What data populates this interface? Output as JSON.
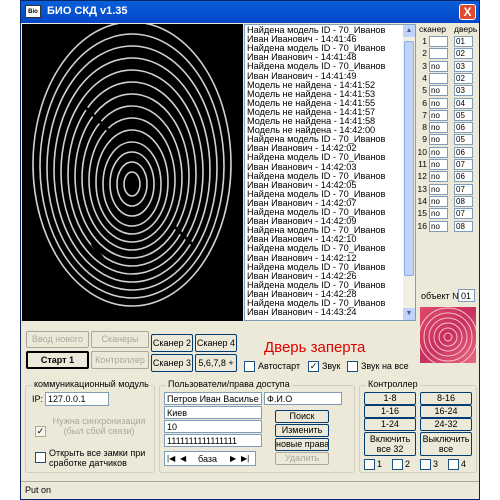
{
  "window": {
    "title": "БИО СКД  v1.35",
    "app_icon": "Bio",
    "close": "X"
  },
  "log": {
    "lines": [
      "Найдена модель ID - 70_Иванов",
      "Иван Иванович - 14:41:46",
      "Найдена модель ID - 70_Иванов",
      "Иван Иванович - 14:41:48",
      "Найдена модель ID - 70_Иванов",
      "Иван Иванович - 14:41:49",
      "Модель не найдена - 14:41:52",
      "Модель не найдена - 14:41:53",
      "Модель не найдена - 14:41:55",
      "Модель не найдена - 14:41:57",
      "Модель не найдена - 14:41:58",
      "Модель не найдена - 14:42:00",
      "Найдена модель ID - 70_Иванов",
      "Иван Иванович - 14:42:02",
      "Найдена модель ID - 70_Иванов",
      "Иван Иванович - 14:42:03",
      "Найдена модель ID - 70_Иванов",
      "Иван Иванович - 14:42:05",
      "Найдена модель ID - 70_Иванов",
      "Иван Иванович - 14:42:07",
      "Найдена модель ID - 70_Иванов",
      "Иван Иванович - 14:42:09",
      "Найдена модель ID - 70_Иванов",
      "Иван Иванович - 14:42:10",
      "Найдена модель ID - 70_Иванов",
      "Иван Иванович - 14:42:12",
      "Найдена модель ID - 70_Иванов",
      "Иван Иванович - 14:42:26",
      "Найдена модель ID - 70_Иванов",
      "Иван Иванович - 14:42:28",
      "Найдена модель ID - 70_Иванов",
      "Иван Иванович - 14:43:24"
    ]
  },
  "scanner_table": {
    "header_scanner": "сканер",
    "header_door": "дверь",
    "rows": [
      [
        "1",
        "",
        "01"
      ],
      [
        "2",
        "",
        "02"
      ],
      [
        "3",
        "no",
        "03"
      ],
      [
        "4",
        "",
        "02"
      ],
      [
        "5",
        "no",
        "03"
      ],
      [
        "6",
        "no",
        "04"
      ],
      [
        "7",
        "no",
        "05"
      ],
      [
        "8",
        "no",
        "06"
      ],
      [
        "9",
        "no",
        "05"
      ],
      [
        "10",
        "no",
        "06"
      ],
      [
        "11",
        "no",
        "07"
      ],
      [
        "12",
        "no",
        "06"
      ],
      [
        "13",
        "no",
        "07"
      ],
      [
        "14",
        "no",
        "08"
      ],
      [
        "15",
        "no",
        "07"
      ],
      [
        "16",
        "no",
        "08"
      ]
    ]
  },
  "object": {
    "label": "объект №",
    "value": "01"
  },
  "buttons": {
    "vvod": "Ввод нового",
    "scanners": "Сканеры",
    "start": "Старт 1",
    "controller": "Контроллер",
    "scanner2": "Сканер 2",
    "scanner4": "Сканер 4",
    "scanner3": "Сканер 3",
    "s5678": "5,6,7,8 +"
  },
  "door_status": "Дверь заперта",
  "checks": {
    "autostart": "Автостарт",
    "sound": "Звук",
    "sound_all": "Звук на все"
  },
  "comm": {
    "caption": "коммуникационный модуль",
    "ip_label": "IP:",
    "ip": "127.0.0.1",
    "sync": "Нужна синхронизация (был сбой связи)",
    "open_locks": "Открыть все замки при сработке датчиков"
  },
  "users": {
    "caption": "Пользователи/права доступа",
    "name": "Петров Иван Василье",
    "fio": "Ф.И.О",
    "city": "Киев",
    "num": "10",
    "bits": "1111111111111111",
    "search": "Поиск",
    "change": "Изменить",
    "new_rights": "новые права",
    "delete": "Удалить",
    "nav_label": "база",
    "nav_first": "|◀",
    "nav_prev": "◀",
    "nav_next": "▶",
    "nav_last": "▶|"
  },
  "controller": {
    "caption": "Контроллер",
    "b1_8": "1-8",
    "b8_16": "8-16",
    "b1_16": "1-16",
    "b16_24": "16-24",
    "b1_24": "1-24",
    "b24_32": "24-32",
    "on_all": "Включить все 32",
    "off_all": "Выключить все",
    "c1": "1",
    "c2": "2",
    "c3": "3",
    "c4": "4"
  },
  "status": "Put on"
}
